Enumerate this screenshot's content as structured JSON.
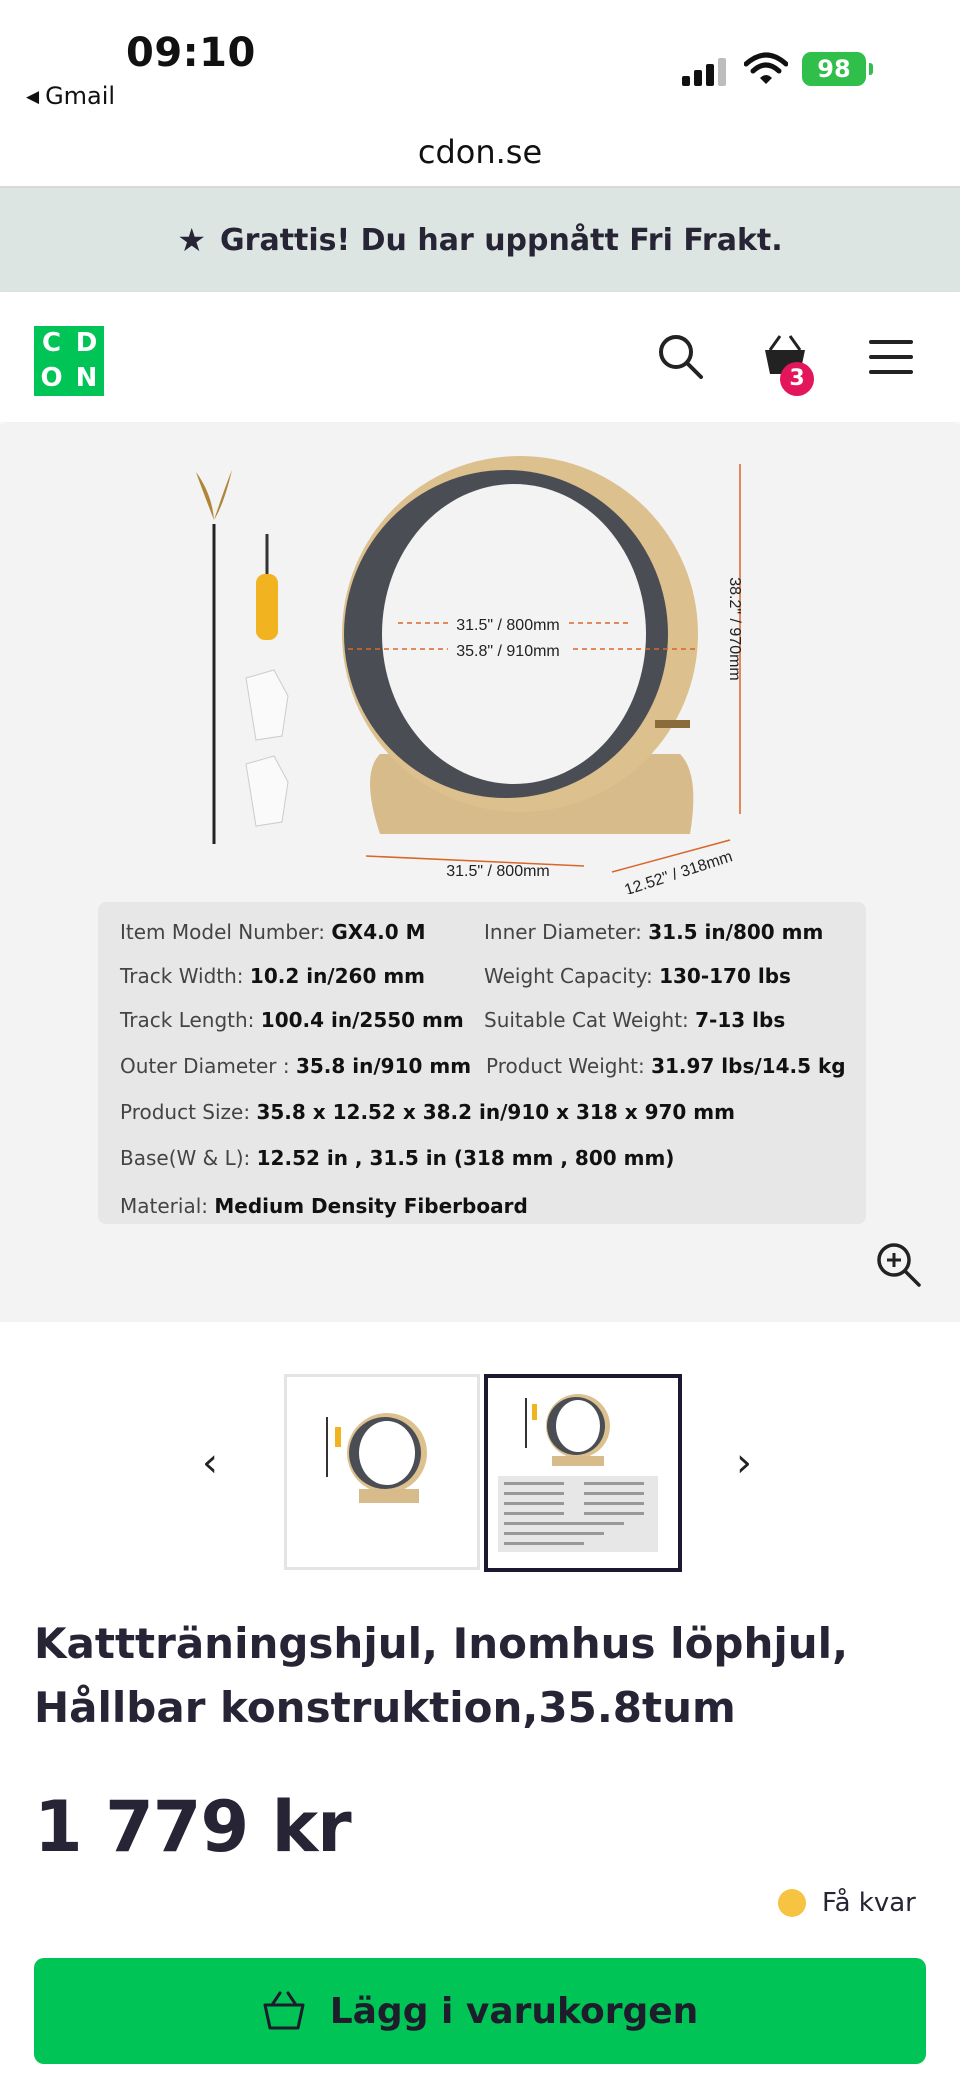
{
  "status_bar": {
    "time": "09:10",
    "back_app": "Gmail",
    "battery": "98"
  },
  "browser": {
    "url": "cdon.se"
  },
  "promo": {
    "text": "Grattis! Du har uppnått Fri Frakt."
  },
  "header": {
    "logo_letters": [
      "C",
      "D",
      "O",
      "N"
    ],
    "cart_count": "3"
  },
  "product_image": {
    "labels": {
      "inner": "31.5\" / 800mm",
      "outer": "35.8\" / 910mm",
      "height": "38.2\" / 970mm",
      "width": "31.5\" / 800mm",
      "depth": "12.52\" / 318mm"
    },
    "specs": [
      {
        "label": "Item Model Number:",
        "value": "GX4.0 M"
      },
      {
        "label": "Inner Diameter:",
        "value": "31.5 in/800 mm"
      },
      {
        "label": "Track Width:",
        "value": "10.2 in/260 mm"
      },
      {
        "label": "Weight Capacity:",
        "value": "130-170 lbs"
      },
      {
        "label": "Track Length:",
        "value": "100.4 in/2550 mm"
      },
      {
        "label": "Suitable Cat Weight:",
        "value": "7-13 lbs"
      },
      {
        "label": "Outer Diameter :",
        "value": "35.8 in/910 mm"
      },
      {
        "label": "Product Weight:",
        "value": "31.97 lbs/14.5 kg"
      },
      {
        "label": "Product Size:",
        "value": "35.8 x 12.52 x 38.2 in/910 x 318 x 970 mm"
      },
      {
        "label": "Base(W & L):",
        "value": "12.52 in , 31.5 in (318 mm , 800 mm)"
      },
      {
        "label": "Material:",
        "value": "Medium Density Fiberboard"
      }
    ]
  },
  "thumbnails": {
    "prev": "‹",
    "next": "›"
  },
  "product": {
    "title": "Kattträningshjul, Inomhus löphjul, Hållbar konstruktion,35.8tum",
    "price": "1 779 kr",
    "stock": "Få kvar",
    "add_to_cart": "Lägg i varukorgen"
  },
  "colors": {
    "brand_green": "#00c455",
    "badge_pink": "#e3165b",
    "stock_yellow": "#f6c343",
    "promo_bg": "#dce5e1"
  }
}
